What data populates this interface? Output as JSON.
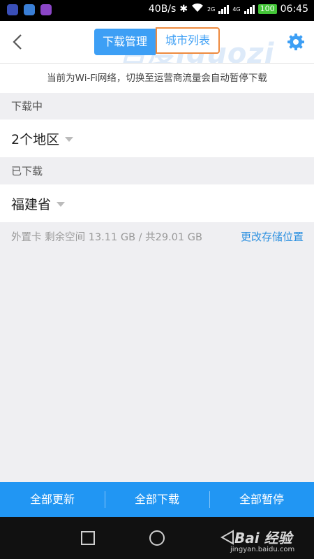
{
  "status_bar": {
    "speed": "40B/s",
    "network_2g": "2G",
    "network_4g": "4G",
    "battery": "100",
    "time": "06:45",
    "app_icon_colors": [
      "#3a4fb8",
      "#3a7fd6",
      "#8b46c7"
    ]
  },
  "header": {
    "tabs": [
      {
        "label": "下载管理",
        "active": true
      },
      {
        "label": "城市列表",
        "active": false
      }
    ],
    "watermark": "百度iguozi"
  },
  "notice": "当前为Wi-Fi网络，切换至运营商流量会自动暂停下载",
  "downloading": {
    "label": "下载中",
    "item": "2个地区"
  },
  "downloaded": {
    "label": "已下载",
    "item": "福建省"
  },
  "storage": {
    "info": "外置卡 剩余空间 13.11 GB / 共29.01 GB",
    "change_link": "更改存储位置"
  },
  "bottom_actions": [
    {
      "label": "全部更新"
    },
    {
      "label": "全部下载"
    },
    {
      "label": "全部暂停"
    }
  ],
  "watermark_footer": {
    "brand": "Bai 经验",
    "url": "jingyan.baidu.com"
  },
  "colors": {
    "accent": "#3d9ff5",
    "highlight_border": "#ee8a3e",
    "bottom_bar": "#2196f3",
    "link": "#2a8fe0"
  }
}
